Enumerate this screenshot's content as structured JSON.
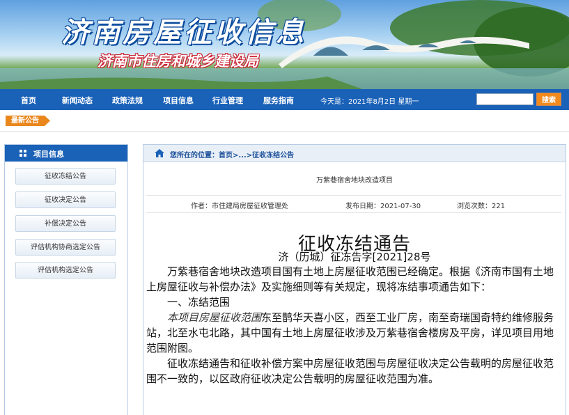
{
  "banner": {
    "title": "济南房屋征收信息",
    "subtitle": "济南市住房和城乡建设局"
  },
  "nav": {
    "items": [
      "首页",
      "新闻动态",
      "政策法规",
      "项目信息",
      "行业管理",
      "服务指南"
    ],
    "date": "今天是：2021年8月2日  星期一",
    "search_placeholder": "",
    "search_label": "搜索"
  },
  "latest": {
    "label": "最新公告"
  },
  "sidebar": {
    "title": "项目信息",
    "items": [
      "征收冻结公告",
      "征收决定公告",
      "补偿决定公告",
      "评估机构协商选定公告",
      "评估机构选定公告"
    ]
  },
  "breadcrumb": {
    "prefix": "您所在的位置：",
    "home": "首页",
    "sep": ">...>",
    "current": "征收冻结公告"
  },
  "article": {
    "project": "万紫巷宿舍地块改造项目",
    "author": "作者：市住建局房屋征收管理处",
    "date": "发布日期：2021-07-30",
    "views": "浏览次数：221",
    "title": "征收冻结通告",
    "doc_no": "济（历城）征冻告字[2021]28号",
    "p1": "万紫巷宿舍地块改造项目国有土地上房屋征收范围已经确定。根据《济南市国有土地上房屋征收与补偿办法》及实施细则等有关规定，现将冻结事项通告如下：",
    "h1": "一、冻结范围",
    "p2a": "本项目房屋征收范围",
    "p2b": "东至鹊华天喜小区，西至工业厂房，南至奇瑞国奇特约维修服务站，北至水屯北路，其中国有土地上房屋征收涉及万紫巷宿舍楼房及平房，详见项目用地范围附图。",
    "p3": "征收冻结通告和征收补偿方案中房屋征收范围与房屋征收决定公告载明的房屋征收范围不一致的，以区政府征收决定公告载明的房屋征收范围为准。"
  }
}
